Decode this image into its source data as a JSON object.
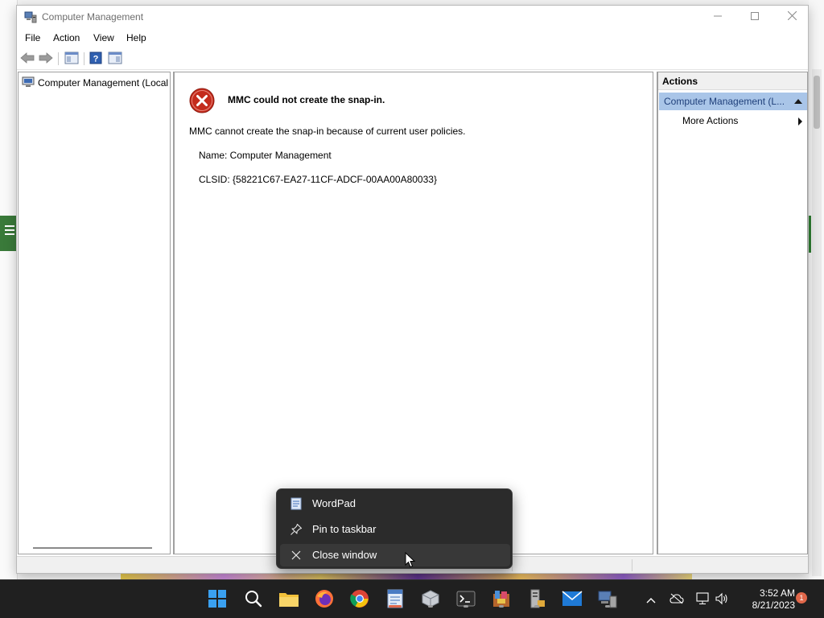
{
  "window": {
    "title": "Computer Management",
    "minimize_icon": "minimize-icon",
    "maximize_icon": "maximize-icon",
    "close_icon": "close-icon"
  },
  "menu": {
    "items": [
      "File",
      "Action",
      "View",
      "Help"
    ]
  },
  "toolbar": {
    "buttons": [
      "back-arrow-icon",
      "forward-arrow-icon",
      "show-hide-console-tree-icon",
      "help-icon",
      "show-hide-action-pane-icon"
    ]
  },
  "tree": {
    "root_label": "Computer Management (Local"
  },
  "error": {
    "title": "MMC could not create the snap-in.",
    "message": "MMC cannot create the snap-in because of current user policies.",
    "name_line": "Name: Computer Management",
    "clsid_line": "CLSID: {58221C67-EA27-11CF-ADCF-00AA00A80033}"
  },
  "actions": {
    "header": "Actions",
    "group_label": "Computer Management (L...",
    "more_actions": "More Actions"
  },
  "jumplist": {
    "items": [
      {
        "label": "WordPad",
        "icon": "wordpad-icon"
      },
      {
        "label": "Pin to taskbar",
        "icon": "pin-icon"
      },
      {
        "label": "Close window",
        "icon": "close-icon"
      }
    ]
  },
  "taskbar": {
    "apps": [
      "start-icon",
      "search-icon",
      "file-explorer-icon",
      "firefox-icon",
      "chrome-icon",
      "wordpad-icon",
      "app-cube-icon",
      "terminal-icon",
      "package-icon",
      "server-manager-icon",
      "mail-icon",
      "computer-management-icon"
    ],
    "clock_time": "3:52 AM",
    "clock_date": "8/21/2023",
    "notification_count": "1"
  },
  "colors": {
    "taskbar_bg": "#202020",
    "accent_active": "#e0674a",
    "action_group_bg": "#a9c5e8",
    "error_red": "#c42b1c"
  }
}
